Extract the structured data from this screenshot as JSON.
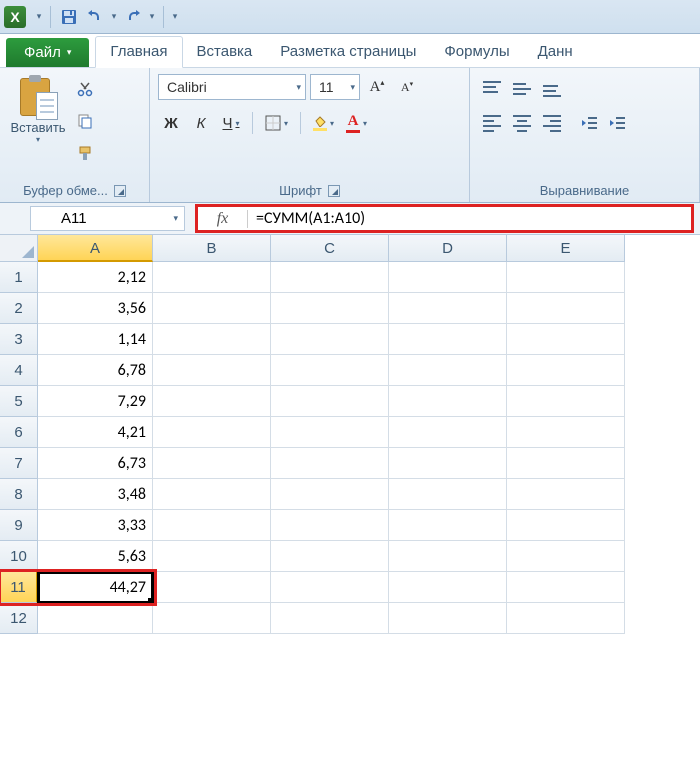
{
  "qat": {
    "excel_letter": "X"
  },
  "tabs": {
    "file": "Файл",
    "home": "Главная",
    "insert": "Вставка",
    "layout": "Разметка страницы",
    "formulas": "Формулы",
    "data": "Данн"
  },
  "ribbon": {
    "clipboard": {
      "paste": "Вставить",
      "group": "Буфер обме..."
    },
    "font": {
      "name": "Calibri",
      "size": "11",
      "bold": "Ж",
      "italic": "К",
      "underline": "Ч",
      "group": "Шрифт"
    },
    "align": {
      "group": "Выравнивание"
    }
  },
  "namebox": "A11",
  "formula": "=СУММ(A1:A10)",
  "fx_label": "fx",
  "columns": [
    "A",
    "B",
    "C",
    "D",
    "E"
  ],
  "col_widths": {
    "A": 115,
    "B": 118,
    "C": 118,
    "D": 118,
    "E": 118
  },
  "rows": [
    "1",
    "2",
    "3",
    "4",
    "5",
    "6",
    "7",
    "8",
    "9",
    "10",
    "11",
    "12"
  ],
  "selected_cell": {
    "row": 11,
    "col": "A"
  },
  "cellsA": [
    "2,12",
    "3,56",
    "1,14",
    "6,78",
    "7,29",
    "4,21",
    "6,73",
    "3,48",
    "3,33",
    "5,63",
    "44,27",
    ""
  ],
  "chart_data": {
    "type": "table",
    "title": "",
    "columns": [
      "A"
    ],
    "rows": [
      {
        "row": 1,
        "A": "2,12"
      },
      {
        "row": 2,
        "A": "3,56"
      },
      {
        "row": 3,
        "A": "1,14"
      },
      {
        "row": 4,
        "A": "6,78"
      },
      {
        "row": 5,
        "A": "7,29"
      },
      {
        "row": 6,
        "A": "4,21"
      },
      {
        "row": 7,
        "A": "6,73"
      },
      {
        "row": 8,
        "A": "3,48"
      },
      {
        "row": 9,
        "A": "3,33"
      },
      {
        "row": 10,
        "A": "5,63"
      },
      {
        "row": 11,
        "A": "44,27"
      }
    ],
    "formula_A11": "=СУММ(A1:A10)"
  }
}
